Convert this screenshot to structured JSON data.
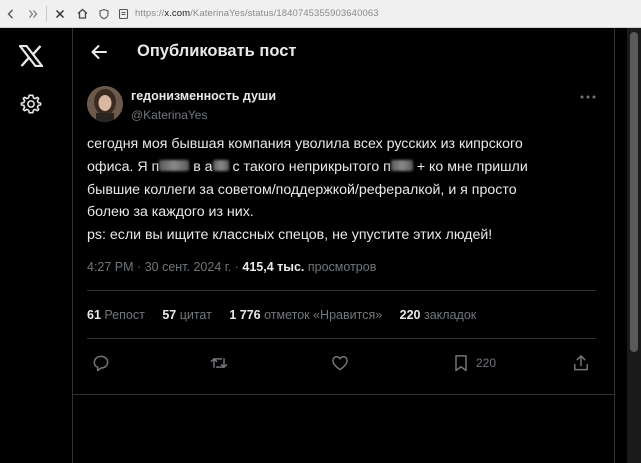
{
  "browser": {
    "url_prefix": "https://",
    "url_host": "x.com",
    "url_path": "/KaterinaYes/status/1840745355903640063"
  },
  "header": {
    "title": "Опубликовать пост"
  },
  "author": {
    "display_name": "гедонизменность души",
    "handle": "@KaterinaYes"
  },
  "tweet": {
    "line1": "сегодня моя бывшая компания уволила всех русских из кипрского",
    "line2_a": "офиса. Я п",
    "line2_b": "в а",
    "line2_c": "с такого неприкрытого п",
    "line2_d": "+ ко мне пришли",
    "line3": "бывшие коллеги за советом/поддержкой/рефералкой, и я просто",
    "line4": "болею за каждого из них.",
    "line5": "ps: если вы ищите классных спецов, не упустите этих людей!"
  },
  "meta": {
    "time": "4:27 PM",
    "dot": "·",
    "date": "30 сент. 2024 г.",
    "views_count": "415,4 тыс.",
    "views_label": "просмотров"
  },
  "stats": {
    "reposts_count": "61",
    "reposts_label": "Репост",
    "quotes_count": "57",
    "quotes_label": "цитат",
    "likes_count": "1 776",
    "likes_label": "отметок «Нравится»",
    "bookmarks_count": "220",
    "bookmarks_label": "закладок"
  },
  "actions": {
    "bookmark_count": "220"
  },
  "icons": [
    "x-logo-icon",
    "settings-icon",
    "back-arrow-icon",
    "more-icon",
    "reply-icon",
    "repost-icon",
    "like-icon",
    "bookmark-icon",
    "share-icon"
  ]
}
